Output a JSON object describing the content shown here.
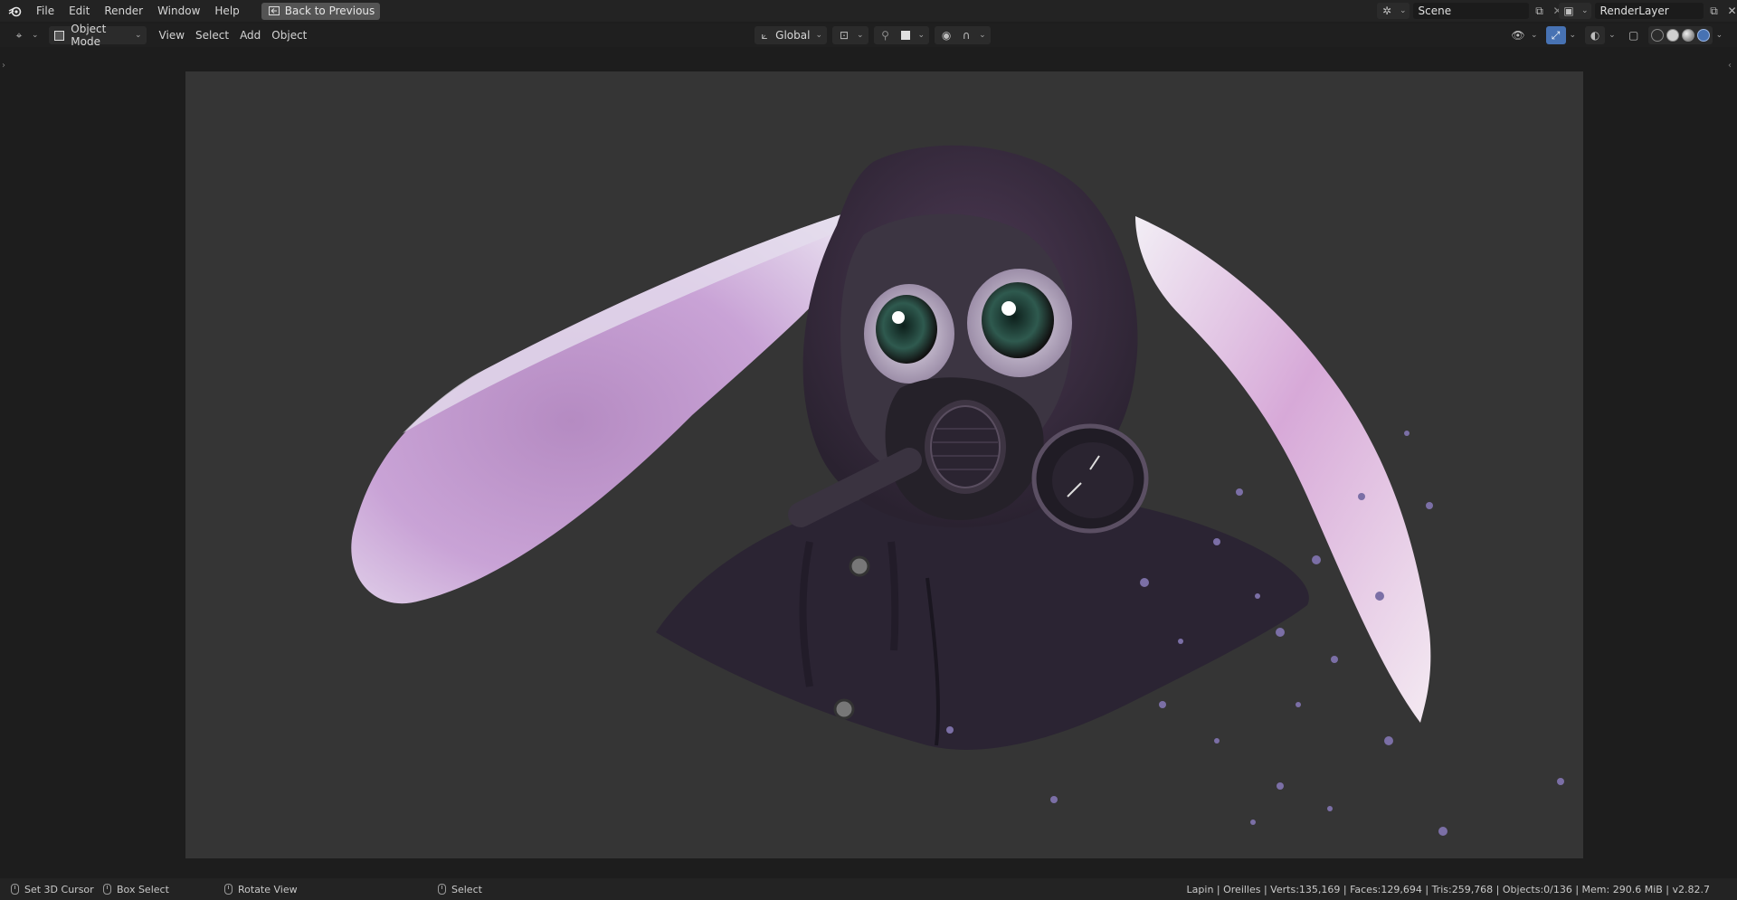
{
  "topbar": {
    "menus": [
      "File",
      "Edit",
      "Render",
      "Window",
      "Help"
    ],
    "back_button": "Back to Previous",
    "scene_name": "Scene",
    "render_layer": "RenderLayer"
  },
  "toolbar": {
    "mode": "Object Mode",
    "menus": [
      "View",
      "Select",
      "Add",
      "Object"
    ],
    "orientation": "Global"
  },
  "status": {
    "left_items": [
      "Set 3D Cursor",
      "Box Select",
      "Rotate View",
      "Select"
    ],
    "stats": "Lapin | Oreilles | Verts:135,169 | Faces:129,694 | Tris:259,768 | Objects:0/136 | Mem: 290.6 MiB | v2.82.7"
  },
  "colors": {
    "viewport_bg": "#353535",
    "accent_blue": "#4772b3",
    "ear_pink": "#c79ccf"
  },
  "icons": [
    "blender-logo-icon",
    "back-icon",
    "editor-type-icon",
    "object-mode-icon",
    "transform-orientation-icon",
    "pivot-icon",
    "snap-icon",
    "proportional-edit-icon",
    "visibility-icon",
    "gizmo-icon",
    "overlay-icon",
    "xray-icon",
    "shading-icons",
    "mouse-icon"
  ]
}
